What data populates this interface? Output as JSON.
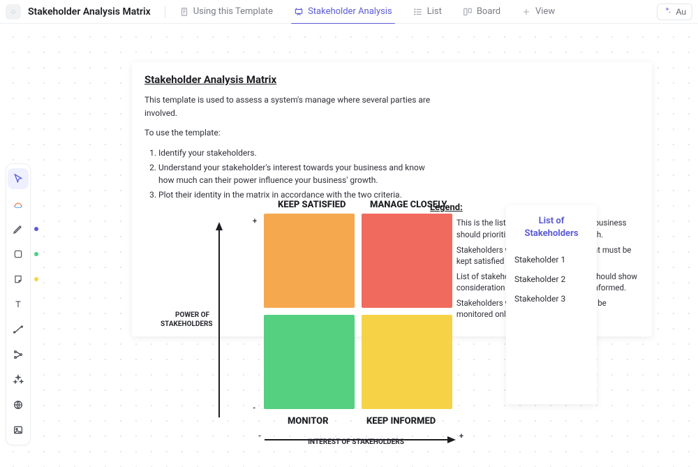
{
  "topbar": {
    "title": "Stakeholder Analysis Matrix",
    "tabs": [
      {
        "label": "Using this Template"
      },
      {
        "label": "Stakeholder Analysis"
      },
      {
        "label": "List"
      },
      {
        "label": "Board"
      }
    ],
    "add_view_label": "View",
    "au_label": "Au"
  },
  "info": {
    "heading": "Stakeholder Analysis Matrix",
    "paragraph": "This template is used to assess a system's manage where several parties are involved.",
    "use_intro": "To use the template:",
    "steps": [
      "Identify your stakeholders.",
      "Understand your stakeholder's interest towards your business and know how much can their power influence your business' growth.",
      "Plot their identity in the matrix in accordance with the two criteria."
    ],
    "legend_heading": "Legend:",
    "legend": [
      {
        "color": "#f16a5e",
        "text": "This is the list of stakeholders that the business should prioritize and engage closely with."
      },
      {
        "color": "#f5a84e",
        "text": "Stakeholders within the orange quadrant must be kept satisfied by meeting their needs."
      },
      {
        "color": "#f6d346",
        "text": "List of stakeholders that the business should show consideration to by just keeping them informed."
      },
      {
        "color": "#55cf80",
        "text": "Stakeholders within this quadrant must be monitored only with minimal effort."
      }
    ]
  },
  "matrix": {
    "y_axis": "POWER OF STAKEHOLDERS",
    "x_axis": "INTEREST OF STAKEHOLDERS",
    "y_high": "+",
    "y_low": "-",
    "x_low": "-",
    "x_high": "+",
    "quadrants": {
      "top_left": {
        "label": "KEEP SATISFIED",
        "color": "#f5a84e"
      },
      "top_right": {
        "label": "MANAGE CLOSELY",
        "color": "#f16a5e"
      },
      "bot_left": {
        "label": "MONITOR",
        "color": "#55cf80"
      },
      "bot_right": {
        "label": "KEEP INFORMED",
        "color": "#f6d346"
      }
    }
  },
  "stakeholders": {
    "heading": "List of Stakeholders",
    "items": [
      "Stakeholder 1",
      "Stakeholder 2",
      "Stakeholder 3"
    ]
  }
}
